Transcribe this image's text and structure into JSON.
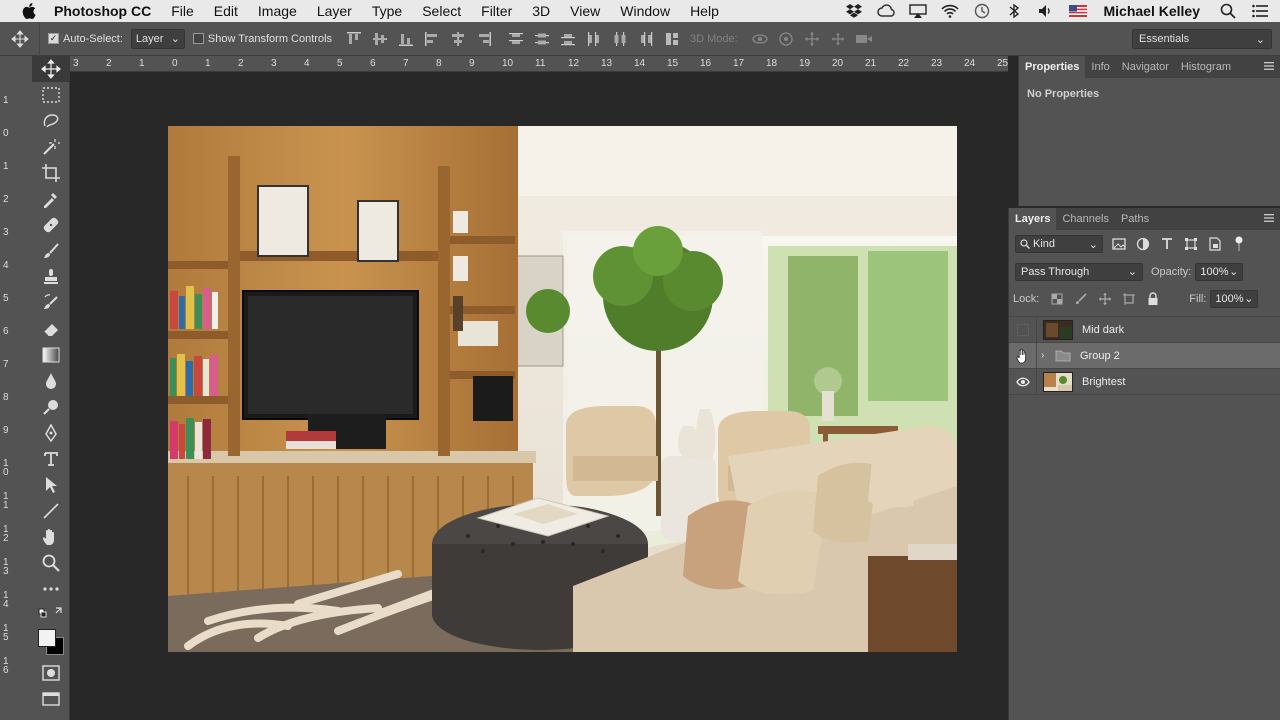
{
  "menubar": {
    "app_name": "Photoshop CC",
    "items": [
      "File",
      "Edit",
      "Image",
      "Layer",
      "Type",
      "Select",
      "Filter",
      "3D",
      "View",
      "Window",
      "Help"
    ],
    "user": "Michael Kelley"
  },
  "options": {
    "auto_select_label": "Auto-Select:",
    "auto_select_checked": true,
    "auto_select_target": "Layer",
    "transform_label": "Show Transform Controls",
    "mode_3d_label": "3D Mode:",
    "workspace": "Essentials"
  },
  "rulers": {
    "top": [
      "3",
      "2",
      "1",
      "0",
      "1",
      "2",
      "3",
      "4",
      "5",
      "6",
      "7",
      "8",
      "9",
      "10",
      "11",
      "12",
      "13",
      "14",
      "15",
      "16",
      "17",
      "18",
      "19",
      "20",
      "21",
      "22",
      "23",
      "24",
      "25"
    ],
    "left": [
      "1",
      "0",
      "1",
      "2",
      "3",
      "4",
      "5",
      "6",
      "7",
      "8",
      "9",
      "1\n0",
      "1\n1",
      "1\n2",
      "1\n3",
      "1\n4",
      "1\n5",
      "1\n6"
    ]
  },
  "properties_panel": {
    "tabs": [
      "Properties",
      "Info",
      "Navigator",
      "Histogram"
    ],
    "body": "No Properties"
  },
  "layers_panel": {
    "tabs": [
      "Layers",
      "Channels",
      "Paths"
    ],
    "filter_kind": "Kind",
    "blend_mode": "Pass Through",
    "opacity_label": "Opacity:",
    "opacity_value": "100%",
    "lock_label": "Lock:",
    "fill_label": "Fill:",
    "fill_value": "100%",
    "layers": [
      {
        "name": "Mid dark",
        "visible": false,
        "type": "pixel"
      },
      {
        "name": "Group 2",
        "visible": false,
        "type": "group"
      },
      {
        "name": "Brightest",
        "visible": true,
        "type": "pixel"
      }
    ]
  }
}
